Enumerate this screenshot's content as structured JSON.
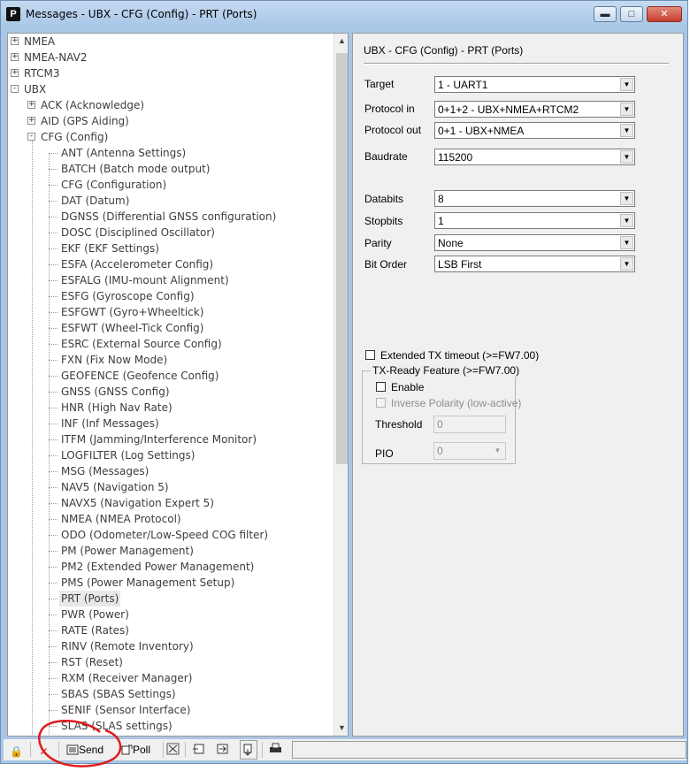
{
  "window": {
    "title": "Messages - UBX - CFG (Config) - PRT (Ports)",
    "app_icon_letter": "P",
    "minimize_glyph": "▬",
    "maximize_glyph": "□",
    "close_glyph": "✕"
  },
  "tree": {
    "items": [
      {
        "label": "NMEA",
        "level": 0,
        "expander": "+"
      },
      {
        "label": "NMEA-NAV2",
        "level": 0,
        "expander": "+"
      },
      {
        "label": "RTCM3",
        "level": 0,
        "expander": "+"
      },
      {
        "label": "UBX",
        "level": 0,
        "expander": "-"
      },
      {
        "label": "ACK (Acknowledge)",
        "level": 1,
        "expander": "+"
      },
      {
        "label": "AID (GPS Aiding)",
        "level": 1,
        "expander": "+"
      },
      {
        "label": "CFG (Config)",
        "level": 1,
        "expander": "-"
      },
      {
        "label": "ANT (Antenna Settings)",
        "level": 2
      },
      {
        "label": "BATCH (Batch mode output)",
        "level": 2
      },
      {
        "label": "CFG (Configuration)",
        "level": 2
      },
      {
        "label": "DAT (Datum)",
        "level": 2
      },
      {
        "label": "DGNSS (Differential GNSS configuration)",
        "level": 2
      },
      {
        "label": "DOSC (Disciplined Oscillator)",
        "level": 2
      },
      {
        "label": "EKF (EKF Settings)",
        "level": 2
      },
      {
        "label": "ESFA (Accelerometer Config)",
        "level": 2
      },
      {
        "label": "ESFALG (IMU-mount Alignment)",
        "level": 2
      },
      {
        "label": "ESFG (Gyroscope Config)",
        "level": 2
      },
      {
        "label": "ESFGWT (Gyro+Wheeltick)",
        "level": 2
      },
      {
        "label": "ESFWT (Wheel-Tick Config)",
        "level": 2
      },
      {
        "label": "ESRC (External Source Config)",
        "level": 2
      },
      {
        "label": "FXN (Fix Now Mode)",
        "level": 2
      },
      {
        "label": "GEOFENCE (Geofence Config)",
        "level": 2
      },
      {
        "label": "GNSS (GNSS Config)",
        "level": 2
      },
      {
        "label": "HNR (High Nav Rate)",
        "level": 2
      },
      {
        "label": "INF (Inf Messages)",
        "level": 2
      },
      {
        "label": "ITFM (Jamming/Interference Monitor)",
        "level": 2
      },
      {
        "label": "LOGFILTER (Log Settings)",
        "level": 2
      },
      {
        "label": "MSG (Messages)",
        "level": 2
      },
      {
        "label": "NAV5 (Navigation 5)",
        "level": 2
      },
      {
        "label": "NAVX5 (Navigation Expert 5)",
        "level": 2
      },
      {
        "label": "NMEA (NMEA Protocol)",
        "level": 2
      },
      {
        "label": "ODO (Odometer/Low-Speed COG filter)",
        "level": 2
      },
      {
        "label": "PM (Power Management)",
        "level": 2
      },
      {
        "label": "PM2 (Extended Power Management)",
        "level": 2
      },
      {
        "label": "PMS (Power Management Setup)",
        "level": 2
      },
      {
        "label": "PRT (Ports)",
        "level": 2,
        "selected": true
      },
      {
        "label": "PWR (Power)",
        "level": 2
      },
      {
        "label": "RATE (Rates)",
        "level": 2
      },
      {
        "label": "RINV (Remote Inventory)",
        "level": 2
      },
      {
        "label": "RST (Reset)",
        "level": 2
      },
      {
        "label": "RXM (Receiver Manager)",
        "level": 2
      },
      {
        "label": "SBAS (SBAS Settings)",
        "level": 2
      },
      {
        "label": "SENIF (Sensor Interface)",
        "level": 2
      },
      {
        "label": "SLAS (SLAS settings)",
        "level": 2
      }
    ],
    "scroll_up_glyph": "▲",
    "scroll_down_glyph": "▼"
  },
  "panel": {
    "title": "UBX - CFG (Config) - PRT (Ports)",
    "fields": {
      "target": {
        "label": "Target",
        "value": "1 - UART1"
      },
      "protocol_in": {
        "label": "Protocol in",
        "value": "0+1+2 - UBX+NMEA+RTCM2"
      },
      "protocol_out": {
        "label": "Protocol out",
        "value": "0+1 - UBX+NMEA"
      },
      "baudrate": {
        "label": "Baudrate",
        "value": "115200"
      },
      "databits": {
        "label": "Databits",
        "value": "8"
      },
      "stopbits": {
        "label": "Stopbits",
        "value": "1"
      },
      "parity": {
        "label": "Parity",
        "value": "None"
      },
      "bit_order": {
        "label": "Bit Order",
        "value": "LSB First"
      }
    },
    "dropdown_glyph": "▼",
    "extended_tx": {
      "label": "Extended TX timeout (>=FW7.00)",
      "checked": false
    },
    "txready": {
      "title": "TX-Ready Feature (>=FW7.00)",
      "enable_label": "Enable",
      "inverse_label": "Inverse Polarity (low-active)",
      "threshold_label": "Threshold",
      "threshold_value": "0",
      "pio_label": "PIO",
      "pio_value": "0"
    }
  },
  "toolbar": {
    "lock_icon": "🔒",
    "cancel_icon": "✕",
    "send_label": "Send",
    "poll_label": "Poll"
  }
}
